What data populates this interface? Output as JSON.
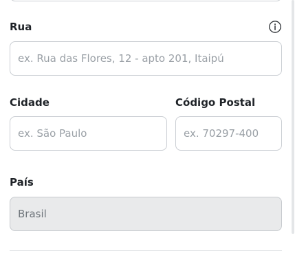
{
  "form": {
    "street": {
      "label": "Rua",
      "placeholder": "ex. Rua das Flores, 12 - apto 201, Itaipú",
      "value": ""
    },
    "city": {
      "label": "Cidade",
      "placeholder": "ex. São Paulo",
      "value": ""
    },
    "postal_code": {
      "label": "Código Postal",
      "placeholder": "ex. 70297-400",
      "value": ""
    },
    "country": {
      "label": "País",
      "value": "Brasil"
    }
  },
  "icons": {
    "street_info": "info-icon"
  }
}
